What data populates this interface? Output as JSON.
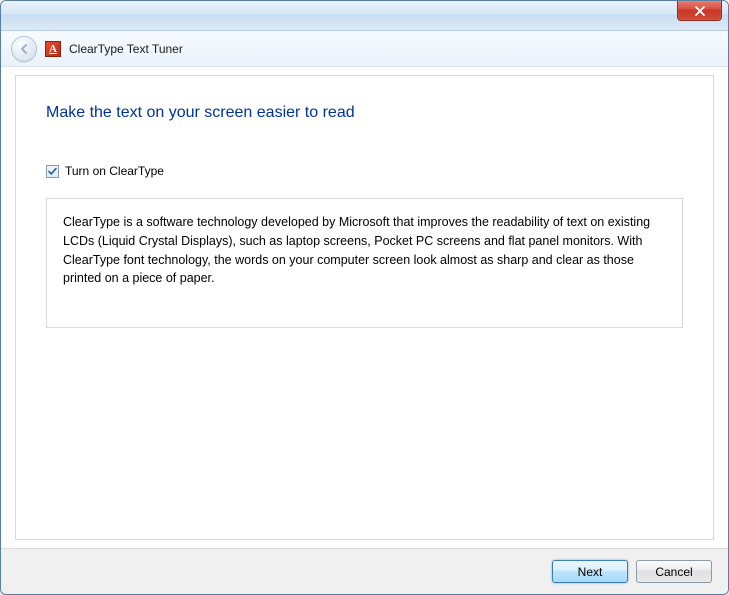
{
  "window": {
    "title": "ClearType Text Tuner",
    "app_icon_letter": "A"
  },
  "main": {
    "heading": "Make the text on your screen easier to read",
    "checkbox_label": "Turn on ClearType",
    "checkbox_checked": true,
    "description": "ClearType is a software technology developed by Microsoft that improves the readability of text on existing LCDs (Liquid Crystal Displays), such as laptop screens, Pocket PC screens and flat panel monitors. With ClearType font technology, the words on your computer screen look almost as sharp and clear as those printed on a piece of paper."
  },
  "footer": {
    "next_label": "Next",
    "cancel_label": "Cancel"
  }
}
